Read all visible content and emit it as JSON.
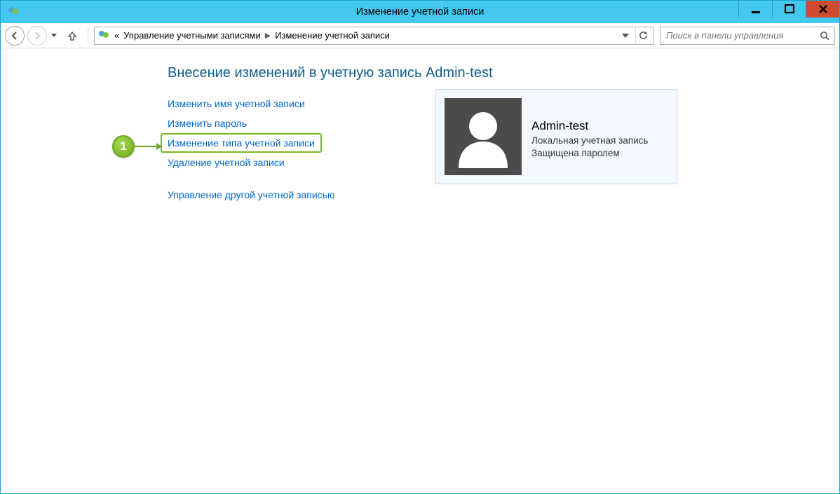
{
  "window": {
    "title": "Изменение учетной записи"
  },
  "breadcrumb": {
    "prefix": "«",
    "level1": "Управление учетными записями",
    "level2": "Изменение учетной записи"
  },
  "search": {
    "placeholder": "Поиск в панели управления"
  },
  "heading": "Внесение изменений в учетную запись Admin-test",
  "tasks": {
    "rename": "Изменить имя учетной записи",
    "change_password": "Изменить пароль",
    "change_type": "Изменение типа учетной записи",
    "delete": "Удаление учетной записи",
    "manage_other": "Управление другой учетной записью"
  },
  "account": {
    "name": "Admin-test",
    "type": "Локальная учетная запись",
    "protection": "Защищена паролем"
  },
  "annotation": {
    "step": "1"
  }
}
